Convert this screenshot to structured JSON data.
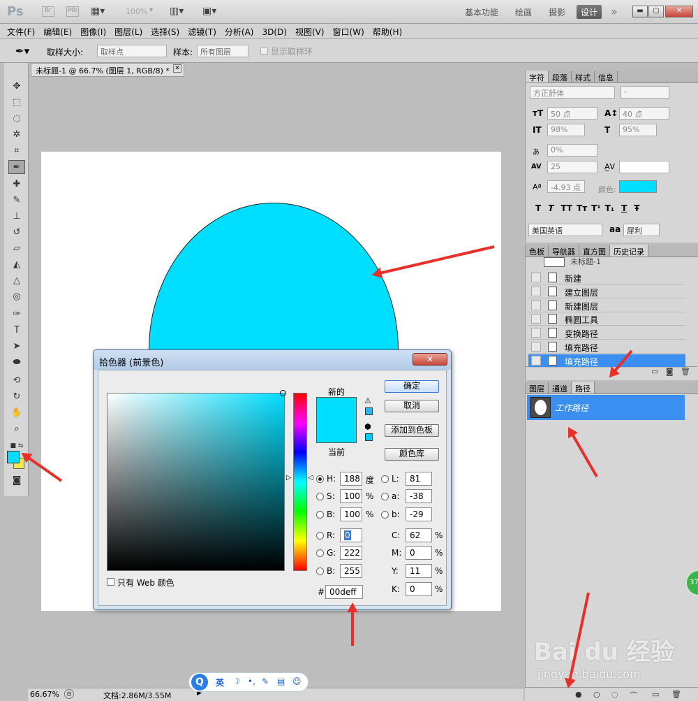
{
  "app": {
    "logo": "Ps",
    "bridge_btn": "Br",
    "minibridge_btn": "Mb",
    "zoom_select": "100%",
    "workspaces": [
      "基本功能",
      "绘画",
      "摄影",
      "设计"
    ],
    "active_workspace": "设计",
    "more_glyph": "»"
  },
  "menu": [
    "文件(F)",
    "编辑(E)",
    "图像(I)",
    "图层(L)",
    "选择(S)",
    "滤镜(T)",
    "分析(A)",
    "3D(D)",
    "视图(V)",
    "窗口(W)",
    "帮助(H)"
  ],
  "options": {
    "sample_size_label": "取样大小:",
    "sample_size_value": "取样点",
    "sample_label": "样本:",
    "sample_value": "所有图层",
    "show_ring_label": "显示取样环"
  },
  "document": {
    "tab_title": "未标题-1 @ 66.7% (图层 1, RGB/8) *",
    "shape_color": "#00deff"
  },
  "status": {
    "zoom": "66.67%",
    "doc_size": "文档:2.86M/3.55M"
  },
  "ime": {
    "logo": "Q",
    "lang": "英",
    "icons": [
      "moon-icon",
      "punct-icon",
      "wrench-icon",
      "clipboard-icon",
      "smile-icon"
    ]
  },
  "char_panel": {
    "tabs": [
      "字符",
      "段落",
      "样式",
      "信息"
    ],
    "font_family": "方正舒体",
    "font_style": "-",
    "size": "50 点",
    "leading": "40 点",
    "vscale": "98%",
    "hscale": "95%",
    "tsume": "0%",
    "tracking": "25",
    "baseline": "-4.93 点",
    "color_label": "颜色:",
    "color": "#00deff",
    "style_buttons": [
      "T",
      "T",
      "TT",
      "Tт",
      "T¹",
      "T₁",
      "T",
      "Ŧ"
    ],
    "language": "美国英语",
    "aa_label": "aa",
    "aa_value": "犀利"
  },
  "history_panel": {
    "tabs": [
      "色板",
      "导航器",
      "直方图",
      "历史记录"
    ],
    "snapshot": "未标题-1",
    "items": [
      "新建",
      "建立图层",
      "新建图层",
      "椭圆工具",
      "变换路径",
      "填充路径",
      "填充路径"
    ]
  },
  "paths_panel": {
    "tabs": [
      "图层",
      "通道",
      "路径"
    ],
    "items": [
      "工作路径"
    ]
  },
  "color_picker": {
    "title": "拾色器 (前景色)",
    "new_label": "新的",
    "current_label": "当前",
    "new_color": "#00deff",
    "current_color": "#00deff",
    "buttons": {
      "ok": "确定",
      "cancel": "取消",
      "add_swatch": "添加到色板",
      "libraries": "颜色库"
    },
    "web_only": "只有 Web 颜色",
    "hsb": {
      "H": "188",
      "S": "100",
      "B": "100"
    },
    "hsb_units": {
      "H": "度",
      "S": "%",
      "B": "%"
    },
    "lab": {
      "L": "81",
      "a": "-38",
      "b": "-29"
    },
    "rgb": {
      "R": "0",
      "G": "222",
      "B": "255"
    },
    "cmyk": {
      "C": "62",
      "M": "0",
      "Y": "11",
      "K": "0"
    },
    "hex": "00deff",
    "field_labels": {
      "H": "H:",
      "S": "S:",
      "B": "B:",
      "R": "R:",
      "G": "G:",
      "Bb": "B:",
      "L": "L:",
      "a": "a:",
      "b": "b:",
      "C": "C:",
      "M": "M:",
      "Y": "Y:",
      "K": "K:",
      "hex": "#"
    }
  },
  "watermark": {
    "brand": "Bai du 经验",
    "url": "jingyan.baidu.com"
  }
}
